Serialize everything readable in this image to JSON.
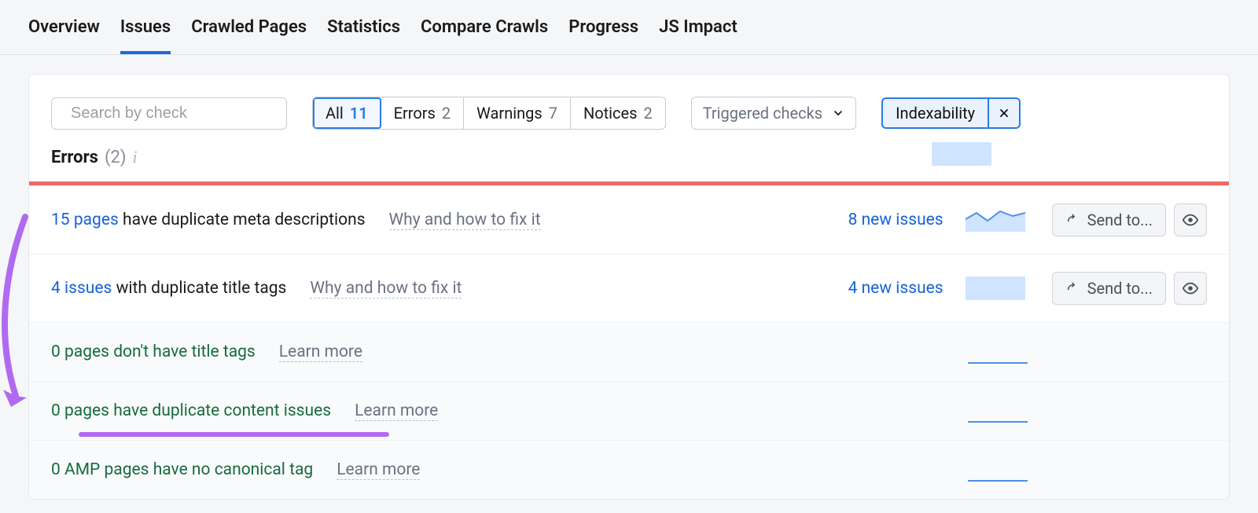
{
  "tabs": [
    "Overview",
    "Issues",
    "Crawled Pages",
    "Statistics",
    "Compare Crawls",
    "Progress",
    "JS Impact"
  ],
  "active_tab": 1,
  "search": {
    "placeholder": "Search by check"
  },
  "filters": {
    "options": [
      {
        "label": "All",
        "count": "11"
      },
      {
        "label": "Errors",
        "count": "2"
      },
      {
        "label": "Warnings",
        "count": "7"
      },
      {
        "label": "Notices",
        "count": "2"
      }
    ],
    "active": 0
  },
  "triggered_label": "Triggered checks",
  "chip": {
    "label": "Indexability"
  },
  "section": {
    "title": "Errors",
    "count": "(2)"
  },
  "rows": [
    {
      "type": "err",
      "lead": "15 pages",
      "rest": " have duplicate meta descriptions",
      "hint": "Why and how to fix it",
      "new": "8 new issues",
      "send": "Send to...",
      "spark": "area"
    },
    {
      "type": "err",
      "lead": "4 issues",
      "rest": " with duplicate title tags",
      "hint": "Why and how to fix it",
      "new": "4 new issues",
      "send": "Send to...",
      "spark": "flat-fill"
    },
    {
      "type": "ok",
      "lead": "0 pages",
      "rest": " don't have title tags",
      "hint": "Learn more",
      "spark": "flat"
    },
    {
      "type": "ok",
      "lead": "0 pages",
      "rest": " have duplicate content issues",
      "hint": "Learn more",
      "spark": "flat"
    },
    {
      "type": "ok",
      "lead": "0 AMP pages",
      "rest": " have no canonical tag",
      "hint": "Learn more",
      "spark": "flat"
    }
  ]
}
